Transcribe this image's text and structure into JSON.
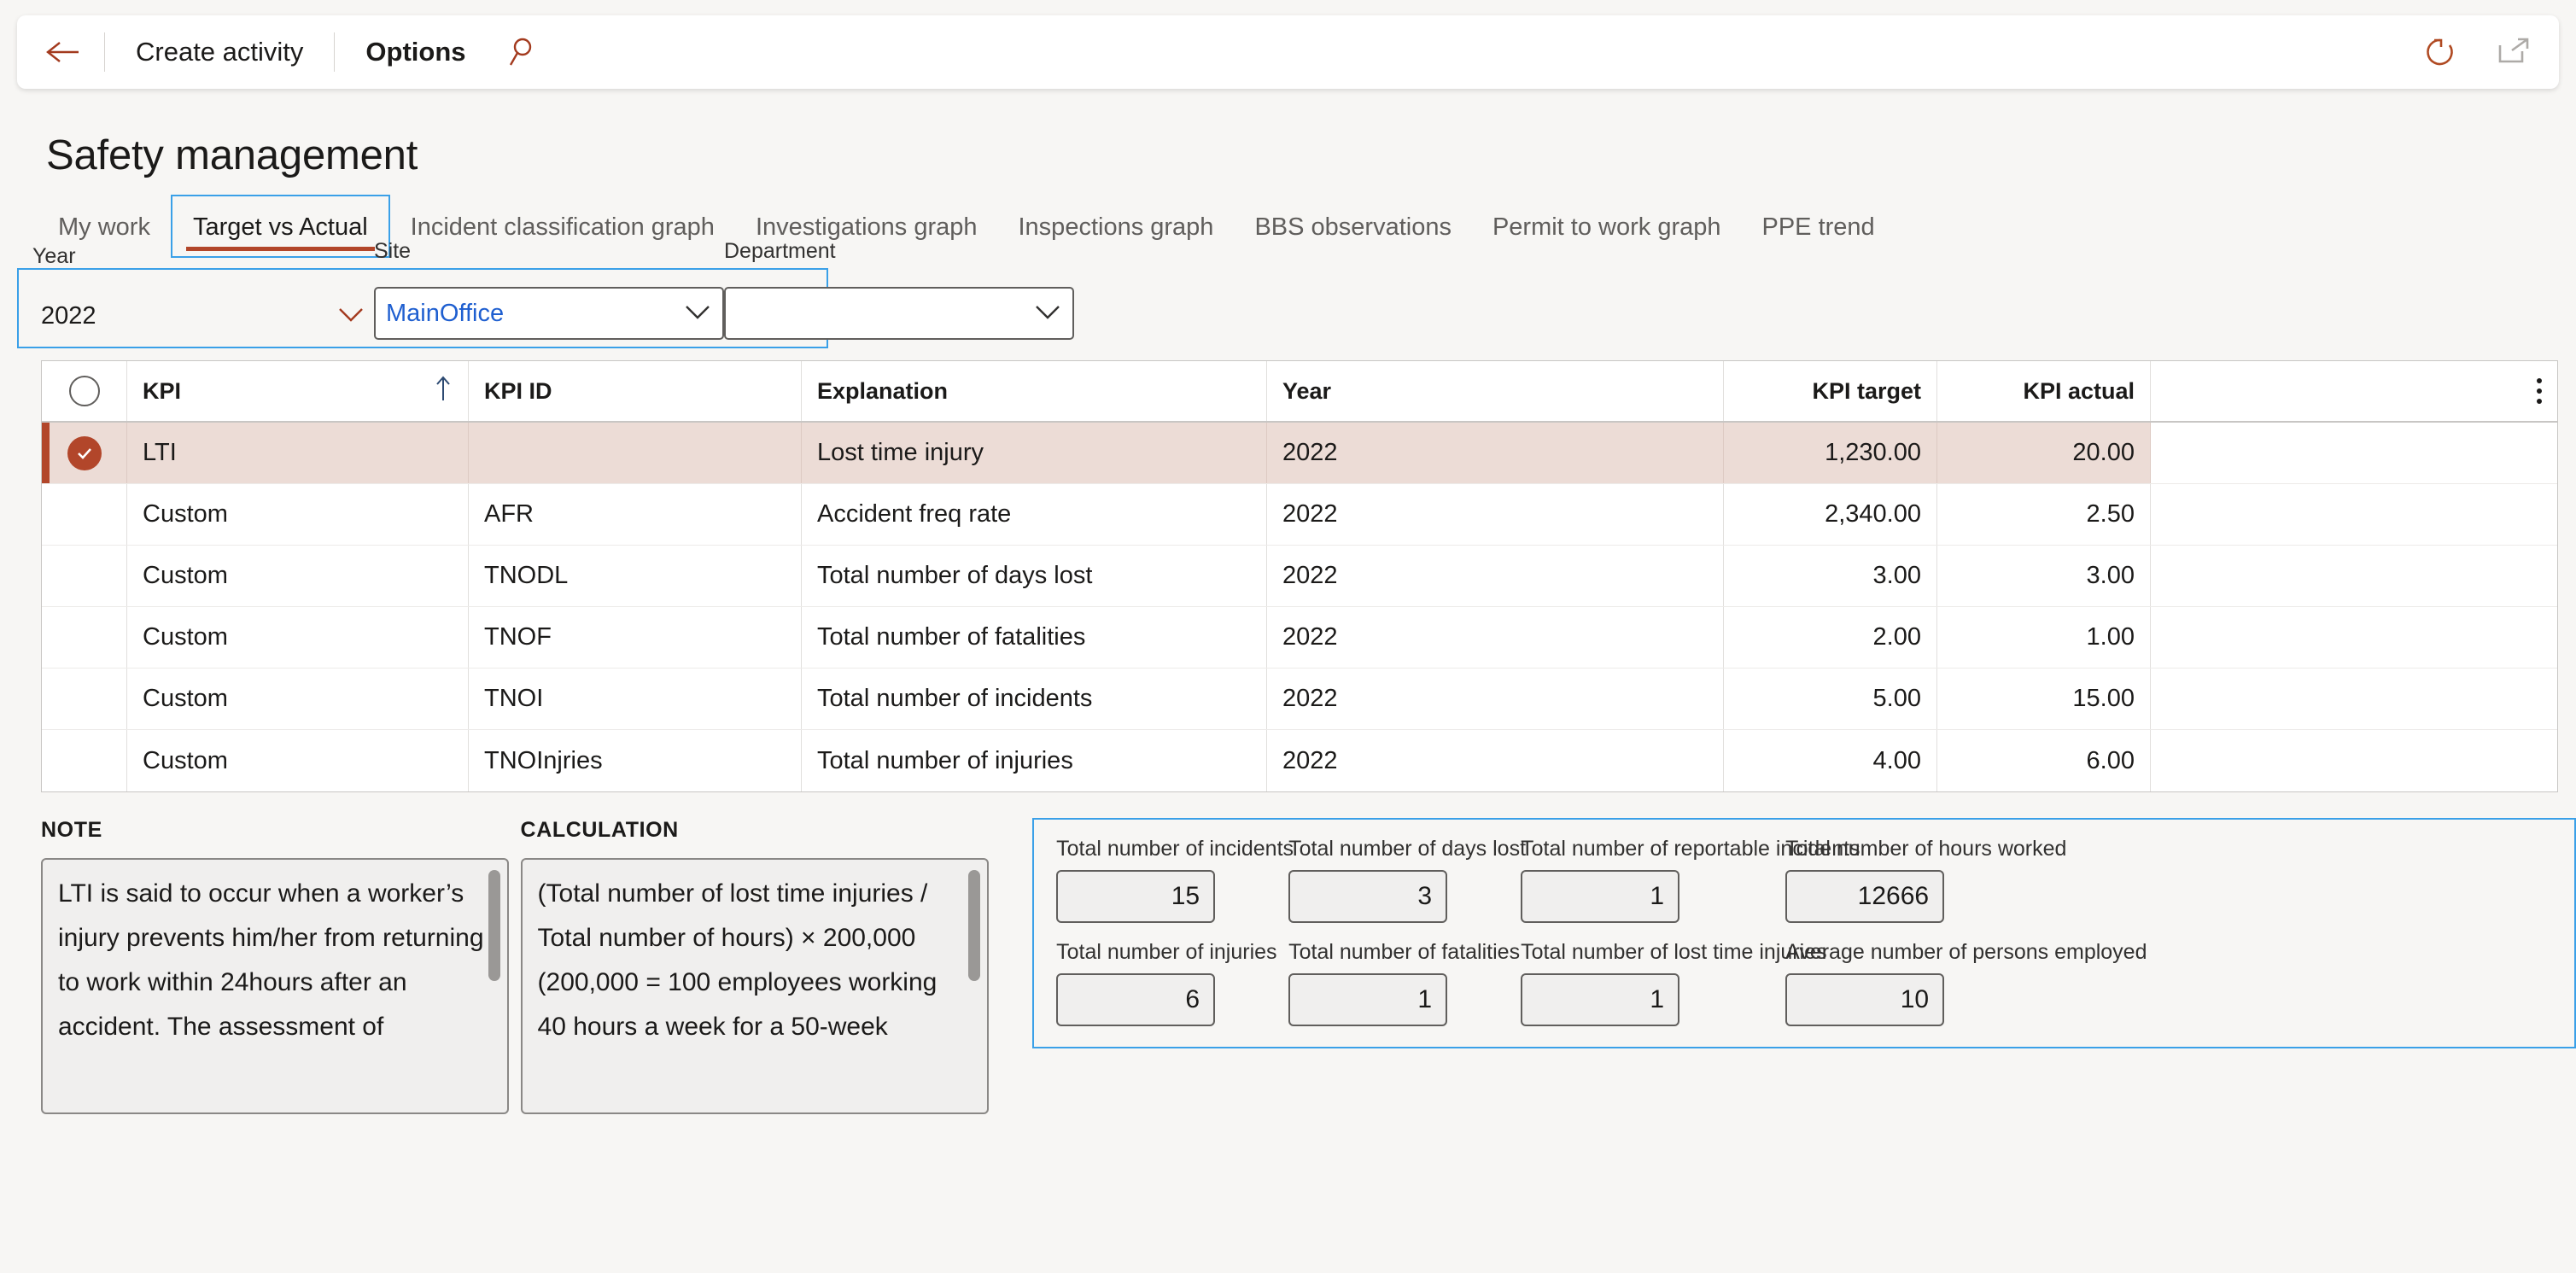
{
  "toolbar": {
    "back_icon": "back-arrow-icon",
    "create_activity": "Create activity",
    "options": "Options",
    "search_icon": "search-icon",
    "refresh_icon": "refresh-icon",
    "popout_icon": "open-in-new-window-icon"
  },
  "page": {
    "title": "Safety management"
  },
  "tabs": [
    {
      "label": "My work",
      "selected": false
    },
    {
      "label": "Target vs Actual",
      "selected": true
    },
    {
      "label": "Incident classification graph",
      "selected": false
    },
    {
      "label": "Investigations graph",
      "selected": false
    },
    {
      "label": "Inspections graph",
      "selected": false
    },
    {
      "label": "BBS observations",
      "selected": false
    },
    {
      "label": "Permit to work graph",
      "selected": false
    },
    {
      "label": "PPE trend",
      "selected": false
    }
  ],
  "filters": {
    "year": {
      "label": "Year",
      "value": "2022"
    },
    "site": {
      "label": "Site",
      "value": "MainOffice"
    },
    "department": {
      "label": "Department",
      "value": ""
    }
  },
  "grid": {
    "columns": [
      "KPI",
      "KPI ID",
      "Explanation",
      "Year",
      "KPI target",
      "KPI actual"
    ],
    "sort": {
      "column": "KPI",
      "direction": "ascending"
    },
    "rows": [
      {
        "selected": true,
        "kpi": "LTI",
        "kpi_id": "",
        "explanation": "Lost time injury",
        "year": "2022",
        "kpi_target": "1,230.00",
        "kpi_actual": "20.00"
      },
      {
        "selected": false,
        "kpi": "Custom",
        "kpi_id": "AFR",
        "explanation": "Accident freq rate",
        "year": "2022",
        "kpi_target": "2,340.00",
        "kpi_actual": "2.50"
      },
      {
        "selected": false,
        "kpi": "Custom",
        "kpi_id": "TNODL",
        "explanation": "Total number of days lost",
        "year": "2022",
        "kpi_target": "3.00",
        "kpi_actual": "3.00"
      },
      {
        "selected": false,
        "kpi": "Custom",
        "kpi_id": "TNOF",
        "explanation": "Total number of fatalities",
        "year": "2022",
        "kpi_target": "2.00",
        "kpi_actual": "1.00"
      },
      {
        "selected": false,
        "kpi": "Custom",
        "kpi_id": "TNOI",
        "explanation": "Total number of incidents",
        "year": "2022",
        "kpi_target": "5.00",
        "kpi_actual": "15.00"
      },
      {
        "selected": false,
        "kpi": "Custom",
        "kpi_id": "TNOInjries",
        "explanation": "Total number of injuries",
        "year": "2022",
        "kpi_target": "4.00",
        "kpi_actual": "6.00"
      }
    ]
  },
  "note": {
    "label": "NOTE",
    "value": "LTI is said to occur when a worker’s injury prevents him/her from returning to work within 24hours after an accident. The assessment of"
  },
  "calculation": {
    "label": "CALCULATION",
    "value": "(Total number of lost time injuries / Total number of hours) × 200,000 (200,000 = 100 employees working 40 hours a week for a 50-week"
  },
  "metrics": [
    {
      "label": "Total number of incidents",
      "value": "15"
    },
    {
      "label": "Total number of days lost",
      "value": "3"
    },
    {
      "label": "Total number of reportable incidents",
      "value": "1"
    },
    {
      "label": "Total number of hours worked",
      "value": "12666"
    },
    {
      "label": "Total number of injuries",
      "value": "6"
    },
    {
      "label": "Total number of fatalities",
      "value": "1"
    },
    {
      "label": "Total number of lost time injuries",
      "value": "1"
    },
    {
      "label": "Average number of persons employed",
      "value": "10"
    }
  ],
  "colors": {
    "accent": "#b2462a",
    "selected_row_bg": "#ecdcd6",
    "focus_border": "#3aa0e8",
    "link_text": "#1f5fd0",
    "page_bg": "#f7f6f4"
  }
}
